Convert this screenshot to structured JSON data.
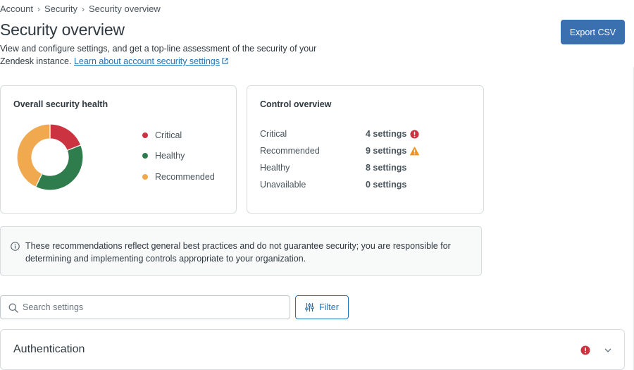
{
  "breadcrumb": {
    "items": [
      "Account",
      "Security",
      "Security overview"
    ]
  },
  "page": {
    "title": "Security overview",
    "description": "View and configure settings, and get a top-line assessment of the security of your Zendesk instance.",
    "link_text": "Learn about account security settings",
    "export_label": "Export CSV"
  },
  "health": {
    "title": "Overall security health",
    "legend": [
      {
        "label": "Critical",
        "color": "#cc3340"
      },
      {
        "label": "Healthy",
        "color": "#2f7d4d"
      },
      {
        "label": "Recommended",
        "color": "#f0a94e"
      }
    ],
    "segments": [
      {
        "name": "Critical",
        "value": 4,
        "color": "#cc3340"
      },
      {
        "name": "Healthy",
        "value": 8,
        "color": "#2f7d4d"
      },
      {
        "name": "Recommended",
        "value": 9,
        "color": "#f0a94e"
      }
    ]
  },
  "control": {
    "title": "Control overview",
    "rows": [
      {
        "label": "Critical",
        "value": "4 settings",
        "icon": "error-icon"
      },
      {
        "label": "Recommended",
        "value": "9 settings",
        "icon": "warning-icon"
      },
      {
        "label": "Healthy",
        "value": "8 settings",
        "icon": ""
      },
      {
        "label": "Unavailable",
        "value": "0 settings",
        "icon": ""
      }
    ]
  },
  "notice": {
    "text": "These recommendations reflect general best practices and do not guarantee security; you are responsible for determining and implementing controls appropriate to your organization."
  },
  "search": {
    "placeholder": "Search settings",
    "value": ""
  },
  "filter": {
    "label": "Filter"
  },
  "sections": [
    {
      "title": "Authentication",
      "status_icon": "error-icon"
    }
  ]
}
